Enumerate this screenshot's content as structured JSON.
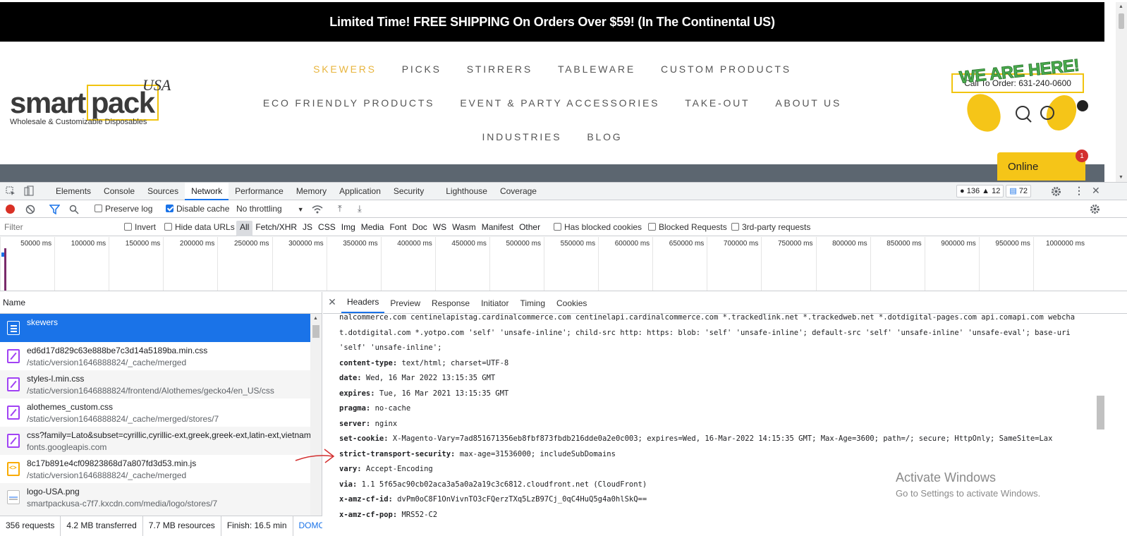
{
  "site": {
    "promo": "Limited Time! FREE SHIPPING On Orders Over $59! (In The Continental US)",
    "logo": {
      "word1": "smart",
      "word2": "pack",
      "usa": "USA",
      "tagline": "Wholesale & Customizable Disposables"
    },
    "nav_rows": [
      [
        "SKEWERS",
        "PICKS",
        "STIRRERS",
        "TABLEWARE",
        "CUSTOM PRODUCTS"
      ],
      [
        "ECO FRIENDLY PRODUCTS",
        "EVENT & PARTY ACCESSORIES",
        "TAKE-OUT",
        "ABOUT US"
      ],
      [
        "INDUSTRIES",
        "BLOG"
      ]
    ],
    "active_nav": "SKEWERS",
    "call_to_order": "Call To Order: 631-240-0600",
    "chat_banner": "WE ARE HERE!",
    "online": "Online",
    "online_badge": "1",
    "colors": {
      "accent": "#e8b53e",
      "promo_bg": "#000000",
      "chat_yellow": "#f5c518",
      "banner_green": "#4caf50"
    }
  },
  "devtools": {
    "tabs": [
      "Elements",
      "Console",
      "Sources",
      "Network",
      "Performance",
      "Memory",
      "Application",
      "Security",
      "Lighthouse",
      "Coverage"
    ],
    "active_tab": "Network",
    "counts": {
      "errors": "136",
      "warnings": "12",
      "messages": "72"
    },
    "toolbar": {
      "preserve_log": "Preserve log",
      "disable_cache": "Disable cache",
      "throttling": "No throttling"
    },
    "filter": {
      "placeholder": "Filter",
      "invert": "Invert",
      "hide_data_urls": "Hide data URLs",
      "types": [
        "All",
        "Fetch/XHR",
        "JS",
        "CSS",
        "Img",
        "Media",
        "Font",
        "Doc",
        "WS",
        "Wasm",
        "Manifest",
        "Other"
      ],
      "has_blocked_cookies": "Has blocked cookies",
      "blocked_requests": "Blocked Requests",
      "third_party": "3rd-party requests"
    },
    "timeline_ticks": [
      "50000 ms",
      "100000 ms",
      "150000 ms",
      "200000 ms",
      "250000 ms",
      "300000 ms",
      "350000 ms",
      "400000 ms",
      "450000 ms",
      "500000 ms",
      "550000 ms",
      "600000 ms",
      "650000 ms",
      "700000 ms",
      "750000 ms",
      "800000 ms",
      "850000 ms",
      "900000 ms",
      "950000 ms",
      "1000000 ms"
    ],
    "list_header": "Name",
    "requests": [
      {
        "name": "skewers",
        "path": "",
        "type": "doc"
      },
      {
        "name": "ed6d17d829c63e888be7c3d14a5189ba.min.css",
        "path": "/static/version1646888824/_cache/merged",
        "type": "css"
      },
      {
        "name": "styles-l.min.css",
        "path": "/static/version1646888824/frontend/Alothemes/gecko4/en_US/css",
        "type": "css"
      },
      {
        "name": "alothemes_custom.css",
        "path": "/static/version1646888824/_cache/merged/stores/7",
        "type": "css"
      },
      {
        "name": "css?family=Lato&subset=cyrillic,cyrillic-ext,greek,greek-ext,latin-ext,vietname",
        "path": "fonts.googleapis.com",
        "type": "css"
      },
      {
        "name": "8c17b891e4cf09823868d7a807fd3d53.min.js",
        "path": "/static/version1646888824/_cache/merged",
        "type": "js"
      },
      {
        "name": "logo-USA.png",
        "path": "smartpackusa-c7f7.kxcdn.com/media/logo/stores/7",
        "type": "img"
      }
    ],
    "status": {
      "requests": "356 requests",
      "transferred": "4.2 MB transferred",
      "resources": "7.7 MB resources",
      "finish": "Finish: 16.5 min",
      "dom": "DOMCo"
    },
    "detail_tabs": [
      "Headers",
      "Preview",
      "Response",
      "Initiator",
      "Timing",
      "Cookies"
    ],
    "active_detail_tab": "Headers",
    "header_lines": [
      {
        "k": "",
        "v": "nalcommerce.com centinelapistag.cardinalcommerce.com centinelapi.cardinalcommerce.com *.trackedlink.net *.trackedweb.net *.dotdigital-pages.com api.comapi.com webcha"
      },
      {
        "k": "",
        "v": "t.dotdigital.com *.yotpo.com 'self' 'unsafe-inline'; child-src http: https: blob: 'self' 'unsafe-inline'; default-src 'self' 'unsafe-inline' 'unsafe-eval'; base-uri"
      },
      {
        "k": "",
        "v": "'self' 'unsafe-inline';"
      },
      {
        "k": "content-type:",
        "v": " text/html; charset=UTF-8"
      },
      {
        "k": "date:",
        "v": " Wed, 16 Mar 2022 13:15:35 GMT"
      },
      {
        "k": "expires:",
        "v": " Tue, 16 Mar 2021 13:15:35 GMT"
      },
      {
        "k": "pragma:",
        "v": " no-cache"
      },
      {
        "k": "server:",
        "v": " nginx"
      },
      {
        "k": "set-cookie:",
        "v": " X-Magento-Vary=7ad851671356eb8fbf873fbdb216dde0a2e0c003; expires=Wed, 16-Mar-2022 14:15:35 GMT; Max-Age=3600; path=/; secure; HttpOnly; SameSite=Lax"
      },
      {
        "k": "strict-transport-security:",
        "v": " max-age=31536000; includeSubDomains"
      },
      {
        "k": "vary:",
        "v": " Accept-Encoding"
      },
      {
        "k": "via:",
        "v": " 1.1 5f65ac90cb02aca3a5a0a2a19c3c6812.cloudfront.net (CloudFront)"
      },
      {
        "k": "x-amz-cf-id:",
        "v": " dvPm0oC8F1OnVivnTO3cFQerzTXq5LzB97Cj_0qC4HuQ5g4a0hlSkQ=="
      },
      {
        "k": "x-amz-cf-pop:",
        "v": " MRS52-C2"
      }
    ]
  },
  "watermark": {
    "line1": "Activate Windows",
    "line2": "Go to Settings to activate Windows."
  }
}
